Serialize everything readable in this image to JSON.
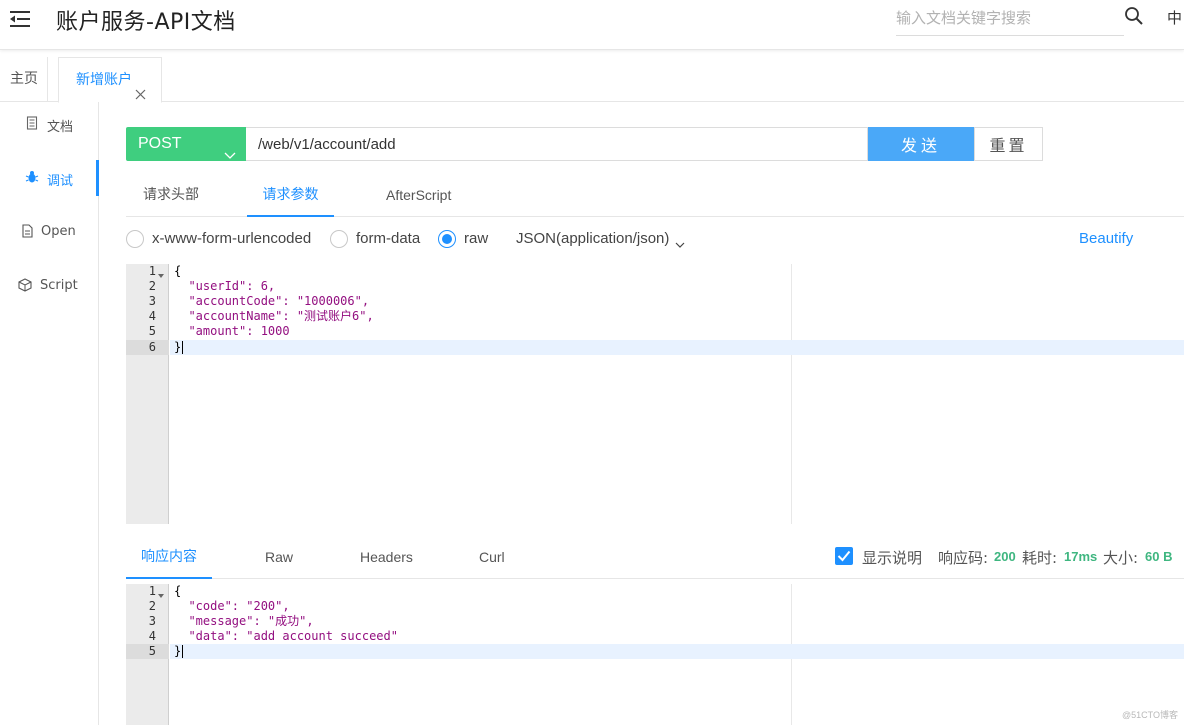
{
  "header": {
    "title": "账户服务-API文档",
    "search_placeholder": "输入文档关键字搜索",
    "lang": "中"
  },
  "tabs": [
    {
      "label": "主页"
    },
    {
      "label": "新增账户"
    }
  ],
  "sidebar": {
    "items": [
      {
        "label": "文档",
        "icon": "document-icon"
      },
      {
        "label": "调试",
        "icon": "bug-icon"
      },
      {
        "label": "Open",
        "icon": "file-icon"
      },
      {
        "label": "Script",
        "icon": "cube-icon"
      }
    ]
  },
  "request": {
    "method": "POST",
    "url": "/web/v1/account/add",
    "send_label": "发送",
    "reset_label": "重置"
  },
  "request_tabs": [
    {
      "label": "请求头部"
    },
    {
      "label": "请求参数"
    },
    {
      "label": "AfterScript"
    }
  ],
  "body_types": {
    "options": [
      "x-www-form-urlencoded",
      "form-data",
      "raw"
    ],
    "selected": "raw",
    "content_type": "JSON(application/json)",
    "beautify_label": "Beautify"
  },
  "request_editor": {
    "line_numbers": [
      "1",
      "2",
      "3",
      "4",
      "5",
      "6"
    ],
    "lines": [
      "{",
      "  \"userId\": 6,",
      "  \"accountCode\": \"1000006\",",
      "  \"accountName\": \"测试账户6\",",
      "  \"amount\": 1000",
      "}"
    ]
  },
  "response_tabs": [
    {
      "label": "响应内容"
    },
    {
      "label": "Raw"
    },
    {
      "label": "Headers"
    },
    {
      "label": "Curl"
    }
  ],
  "response_meta": {
    "show_desc_label": "显示说明",
    "status_label": "响应码:",
    "status_value": "200",
    "time_label": "耗时:",
    "time_value": "17ms",
    "size_label": "大小:",
    "size_value": "60 B"
  },
  "response_editor": {
    "line_numbers": [
      "1",
      "2",
      "3",
      "4",
      "5"
    ],
    "lines": [
      "{",
      "  \"code\": \"200\",",
      "  \"message\": \"成功\",",
      "  \"data\": \"add account succeed\"",
      "}"
    ]
  },
  "watermark": "@51CTO博客",
  "colors": {
    "accent": "#1e90ff",
    "method_bg": "#3fce7f",
    "send_bg": "#4aa8f8",
    "status_green": "#3fb680"
  }
}
